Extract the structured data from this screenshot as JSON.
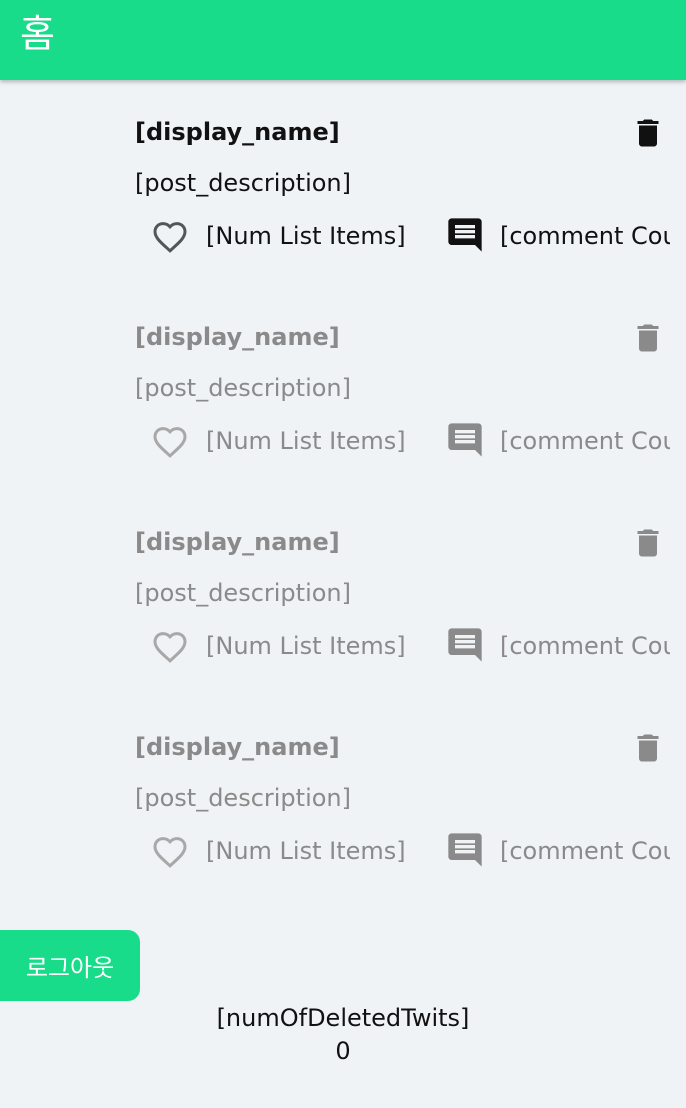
{
  "appbar": {
    "title": "홈"
  },
  "posts": [
    {
      "display_name": "[display_name]",
      "description": "[post_description]",
      "likes_label": "[Num List Items]",
      "comments_label": "[comment Count]",
      "state": "active"
    },
    {
      "display_name": "[display_name]",
      "description": "[post_description]",
      "likes_label": "[Num List Items]",
      "comments_label": "[comment Count]",
      "state": "faded"
    },
    {
      "display_name": "[display_name]",
      "description": "[post_description]",
      "likes_label": "[Num List Items]",
      "comments_label": "[comment Count]",
      "state": "faded"
    },
    {
      "display_name": "[display_name]",
      "description": "[post_description]",
      "likes_label": "[Num List Items]",
      "comments_label": "[comment Count]",
      "state": "faded"
    }
  ],
  "icons": {
    "delete": "trash-icon",
    "like": "heart-outline-icon",
    "comment": "comment-icon"
  },
  "logout_button": {
    "label": "로그아웃"
  },
  "deleted": {
    "label": "[numOfDeletedTwits]",
    "count": "0"
  },
  "colors": {
    "accent": "#19dc8b",
    "background": "#eff3f6",
    "text": "#111111",
    "muted": "#8a8a8a"
  }
}
